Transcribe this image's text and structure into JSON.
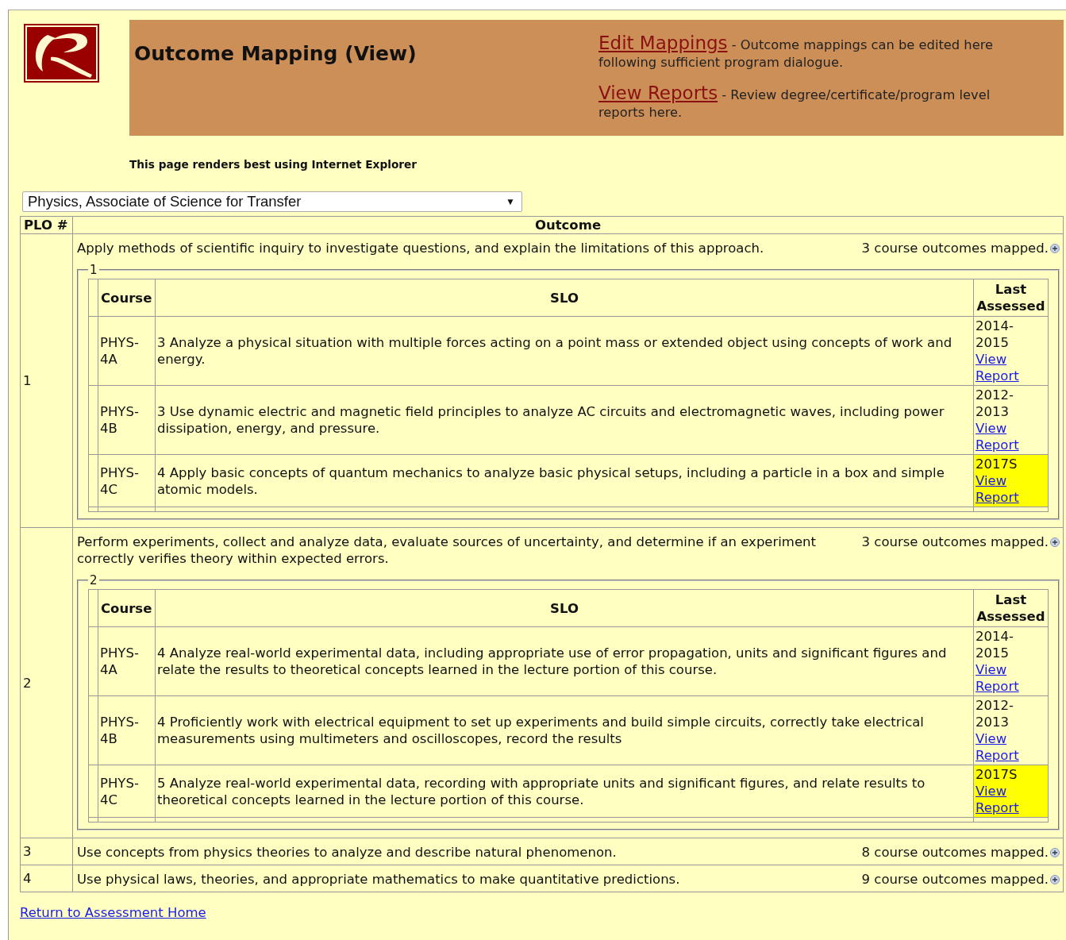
{
  "header": {
    "title": "Outcome Mapping (View)",
    "links": [
      {
        "label": "Edit Mappings",
        "description": " - Outcome mappings can be edited here following sufficient program dialogue."
      },
      {
        "label": "View Reports",
        "description": " - Review degree/certificate/program level reports here."
      }
    ]
  },
  "browser_note": "This page renders best using Internet Explorer",
  "program_select": {
    "value": "Physics, Associate of Science for Transfer",
    "arrow": "▼"
  },
  "table": {
    "columns": [
      "PLO #",
      "Outcome"
    ],
    "rows": [
      {
        "plo": "1",
        "outcome": "Apply methods of scientific inquiry to investigate questions, and explain the limitations of this approach.",
        "mapped": "3 course outcomes mapped.",
        "expanded": true,
        "legend": "1",
        "slo_columns": [
          "Course",
          "SLO",
          "Last Assessed"
        ],
        "slos": [
          {
            "course": "PHYS-4A",
            "slo": "3 Analyze a physical situation with multiple forces acting on a point mass or extended object using concepts of work and energy.",
            "last_assessed": "2014-2015",
            "link": "View Report",
            "highlighted": false
          },
          {
            "course": "PHYS-4B",
            "slo": "3 Use dynamic electric and magnetic field principles to analyze AC circuits and electromagnetic waves, including power dissipation, energy, and pressure.",
            "last_assessed": "2012-2013",
            "link": "View Report",
            "highlighted": false
          },
          {
            "course": "PHYS-4C",
            "slo": "4 Apply basic concepts of quantum mechanics to analyze basic physical setups, including a particle in a box and simple atomic models.",
            "last_assessed": "2017S",
            "link": "View Report",
            "highlighted": true
          }
        ]
      },
      {
        "plo": "2",
        "outcome": "Perform experiments, collect and analyze data, evaluate sources of uncertainty, and determine if an experiment correctly verifies theory within expected errors.",
        "mapped": "3 course outcomes mapped.",
        "expanded": true,
        "legend": "2",
        "slo_columns": [
          "Course",
          "SLO",
          "Last Assessed"
        ],
        "slos": [
          {
            "course": "PHYS-4A",
            "slo": "4 Analyze real-world experimental data, including appropriate use of error propagation, units and significant figures and relate the results to theoretical concepts learned in the lecture portion of this course.",
            "last_assessed": "2014-2015",
            "link": "View Report",
            "highlighted": false
          },
          {
            "course": "PHYS-4B",
            "slo": "4 Proficiently work with electrical equipment to set up experiments and build simple circuits, correctly take electrical measurements using multimeters and oscilloscopes, record the results",
            "last_assessed": "2012-2013",
            "link": "View Report",
            "highlighted": false
          },
          {
            "course": "PHYS-4C",
            "slo": "5 Analyze real-world experimental data, recording with appropriate units and significant figures, and relate results to theoretical concepts learned in the lecture portion of this course.",
            "last_assessed": "2017S",
            "link": "View Report",
            "highlighted": true
          }
        ]
      },
      {
        "plo": "3",
        "outcome": "Use concepts from physics theories to analyze and describe natural phenomenon.",
        "mapped": "8 course outcomes mapped.",
        "expanded": false
      },
      {
        "plo": "4",
        "outcome": "Use physical laws, theories, and appropriate mathematics to make quantitative predictions.",
        "mapped": "9 course outcomes mapped.",
        "expanded": false
      }
    ]
  },
  "footer_link": "Return to Assessment Home"
}
